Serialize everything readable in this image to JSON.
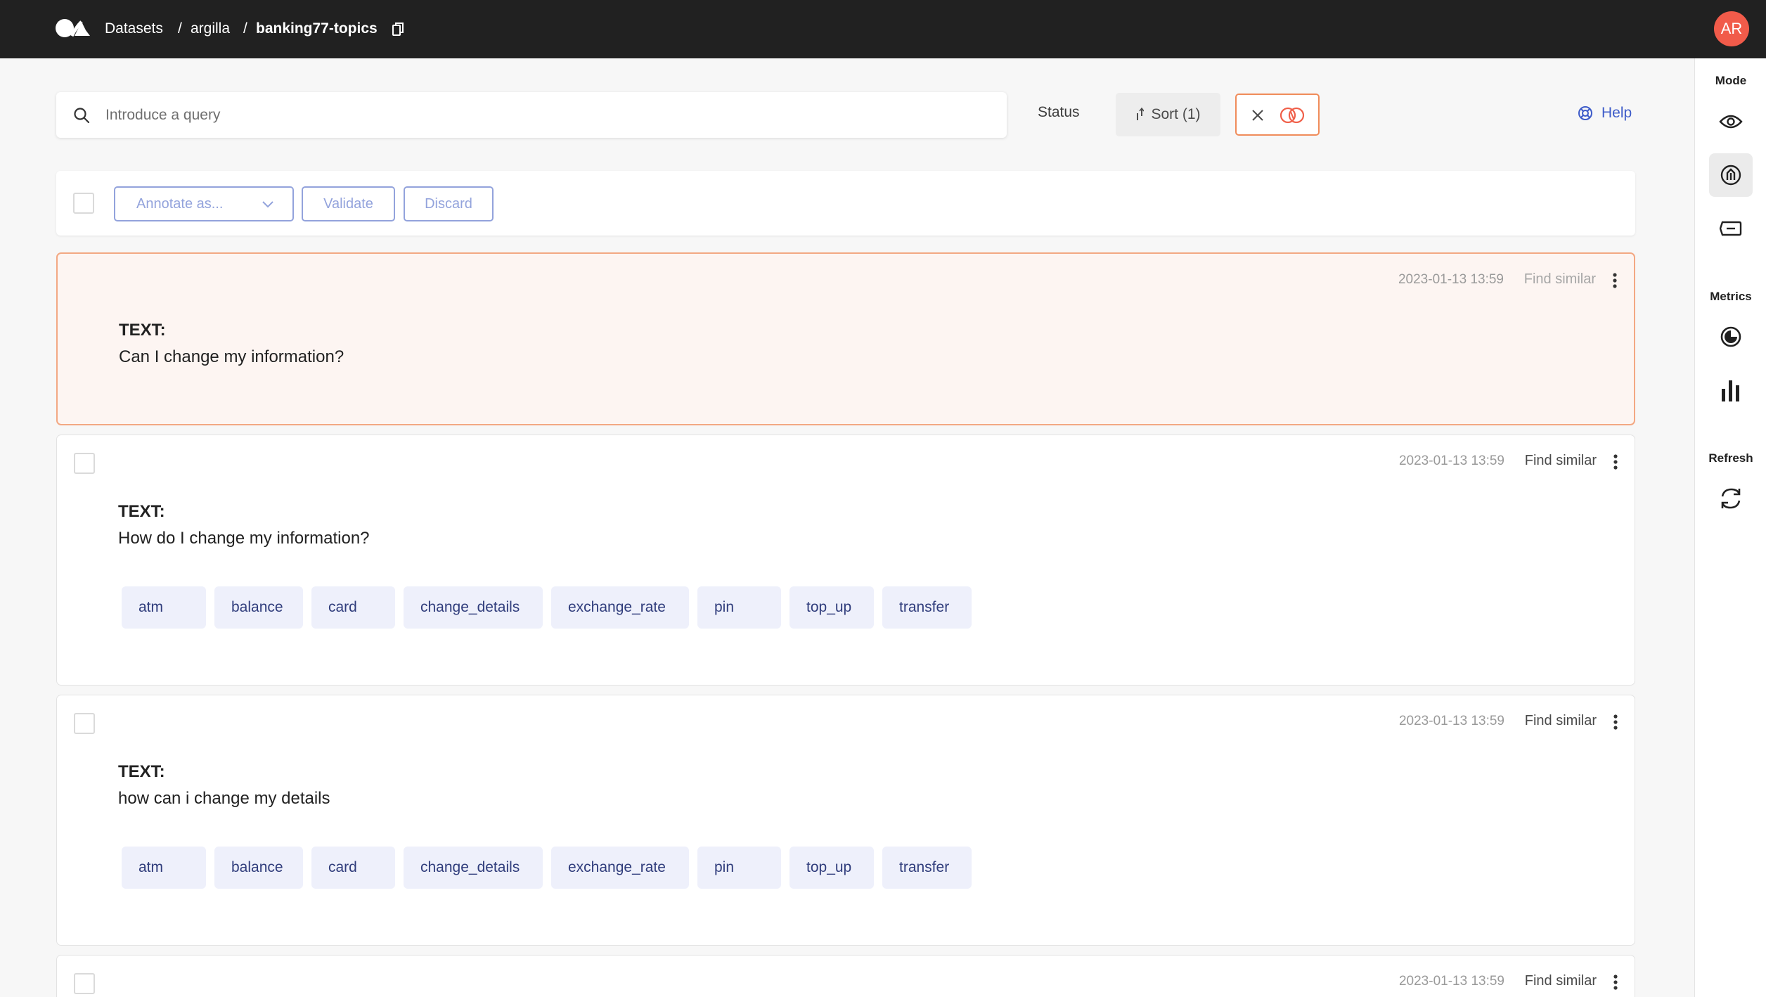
{
  "topbar": {
    "breadcrumbs": [
      "Datasets",
      "argilla",
      "banking77-topics"
    ],
    "separator": "/",
    "avatar_initials": "AR"
  },
  "sidebar": {
    "mode_label": "Mode",
    "metrics_label": "Metrics",
    "refresh_label": "Refresh",
    "mode_items": [
      "explore-icon",
      "annotate-icon",
      "define-labeling-rules-icon"
    ],
    "metrics_items": [
      "progress-icon",
      "stats-icon"
    ],
    "refresh_items": [
      "refresh-icon"
    ]
  },
  "search": {
    "placeholder": "Introduce a query",
    "status_label": "Status",
    "sort_label": "Sort (1)",
    "help_label": "Help"
  },
  "bulk": {
    "annotate_label": "Annotate as...",
    "validate_label": "Validate",
    "discard_label": "Discard"
  },
  "records": [
    {
      "date": "2023-01-13 13:59",
      "find_similar": "Find similar",
      "field": "TEXT:",
      "text": "Can I change my information?",
      "labels": []
    },
    {
      "date": "2023-01-13 13:59",
      "find_similar": "Find similar",
      "field": "TEXT:",
      "text": "How do I change my information?",
      "labels": [
        "atm",
        "balance",
        "card",
        "change_details",
        "exchange_rate",
        "pin",
        "top_up",
        "transfer"
      ]
    },
    {
      "date": "2023-01-13 13:59",
      "find_similar": "Find similar",
      "field": "TEXT:",
      "text": "how can i change my details",
      "labels": [
        "atm",
        "balance",
        "card",
        "change_details",
        "exchange_rate",
        "pin",
        "top_up",
        "transfer"
      ]
    },
    {
      "date": "2023-01-13 13:59",
      "find_similar": "Find similar",
      "field": "",
      "text": "",
      "labels": []
    }
  ],
  "colors": {
    "topbar": "#212121",
    "accent": "#3e5cc9",
    "avatar": "#f15b4a",
    "highlight_border": "#f3a883",
    "chip_bg": "#eef0fb"
  }
}
